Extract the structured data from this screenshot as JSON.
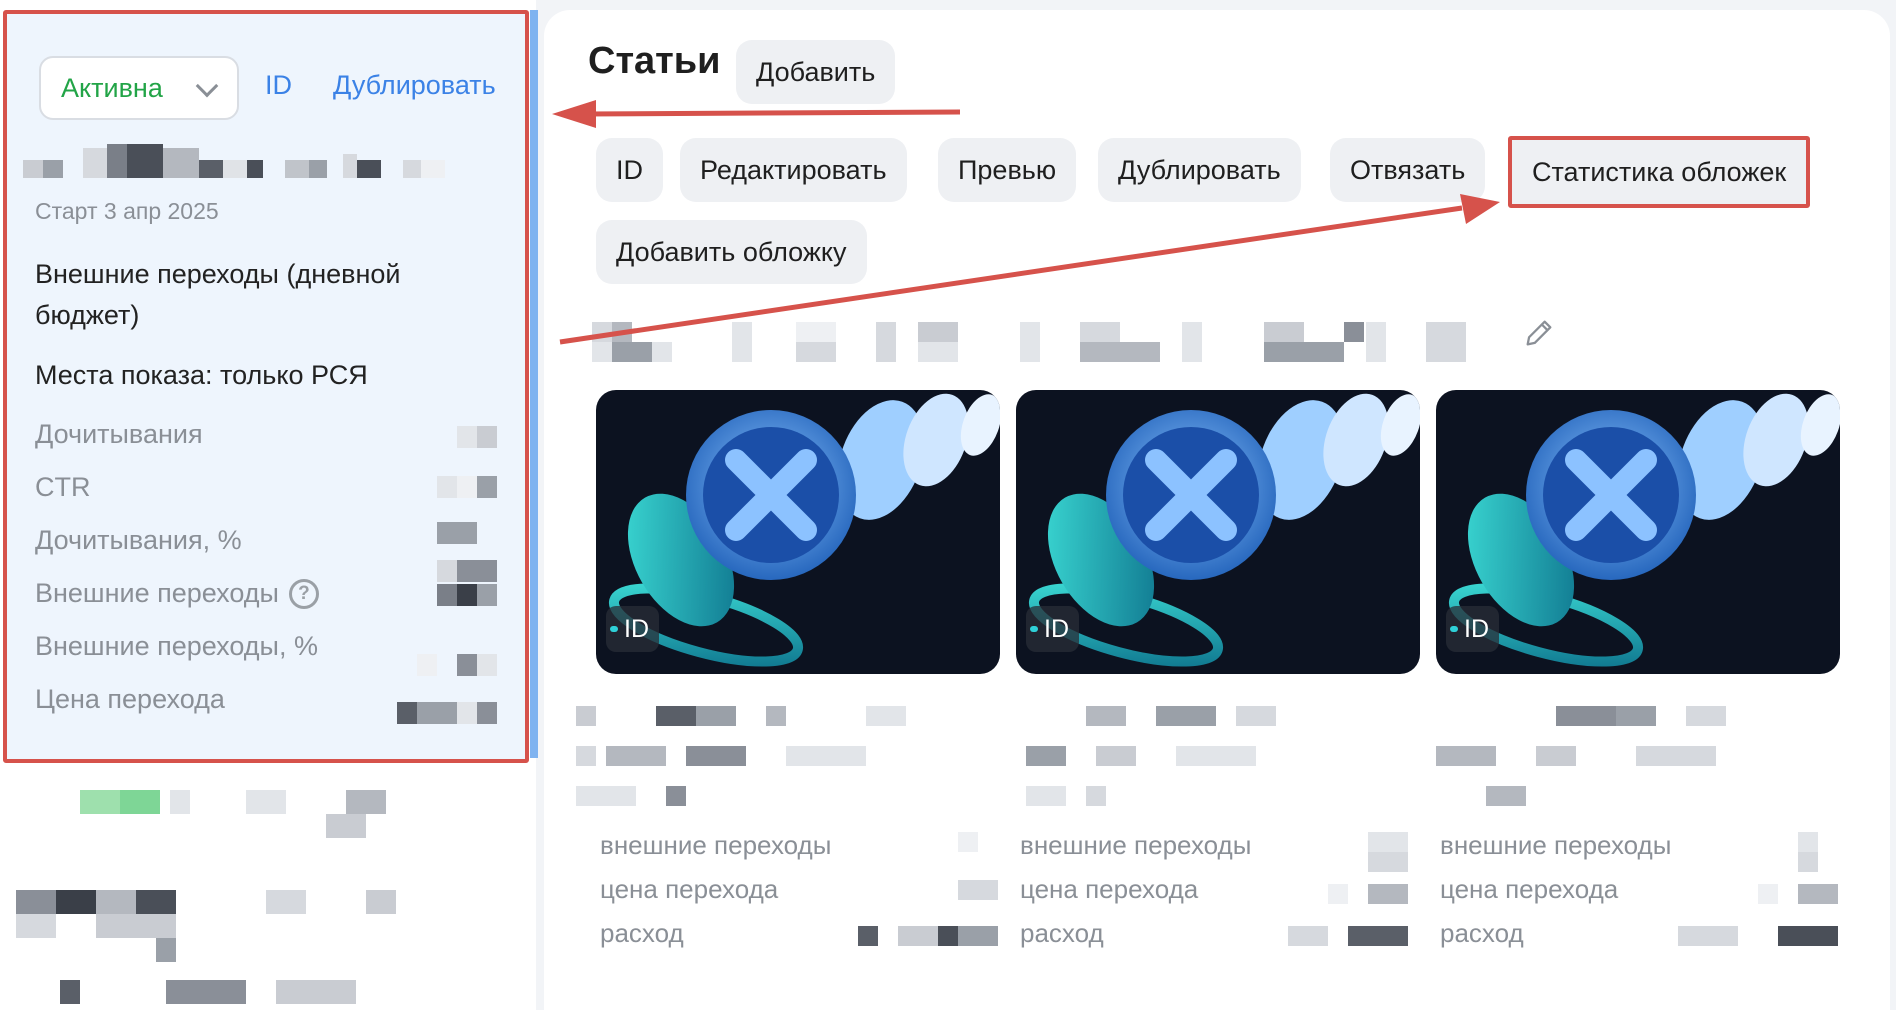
{
  "left": {
    "status_value": "Активна",
    "id_link": "ID",
    "duplicate_link": "Дублировать",
    "start_date": "Старт 3 апр 2025",
    "goal": "Внешние переходы (дневной бюджет)",
    "places": "Места показа: только РСЯ",
    "metrics": [
      {
        "label": "Дочитывания"
      },
      {
        "label": "CTR"
      },
      {
        "label": "Дочитывания, %"
      },
      {
        "label": "Внешние переходы"
      },
      {
        "label": "Внешние переходы, %"
      },
      {
        "label": "Цена перехода"
      }
    ]
  },
  "main": {
    "title": "Статьи",
    "add_button": "Добавить",
    "actions": [
      {
        "label": "ID"
      },
      {
        "label": "Редактировать"
      },
      {
        "label": "Превью"
      },
      {
        "label": "Дублировать"
      },
      {
        "label": "Отвязать"
      },
      {
        "label": "Статистика обложек"
      },
      {
        "label": "Добавить обложку"
      }
    ],
    "covers": [
      {
        "badge": "ID",
        "stats": [
          "внешние переходы",
          "цена перехода",
          "расход"
        ]
      },
      {
        "badge": "ID",
        "stats": [
          "внешние переходы",
          "цена перехода",
          "расход"
        ]
      },
      {
        "badge": "ID",
        "stats": [
          "внешние переходы",
          "цена перехода",
          "расход"
        ]
      }
    ]
  },
  "colors": {
    "accent_link": "#3b82e6",
    "status_active": "#22a447",
    "annotation_red": "#d6524b"
  }
}
